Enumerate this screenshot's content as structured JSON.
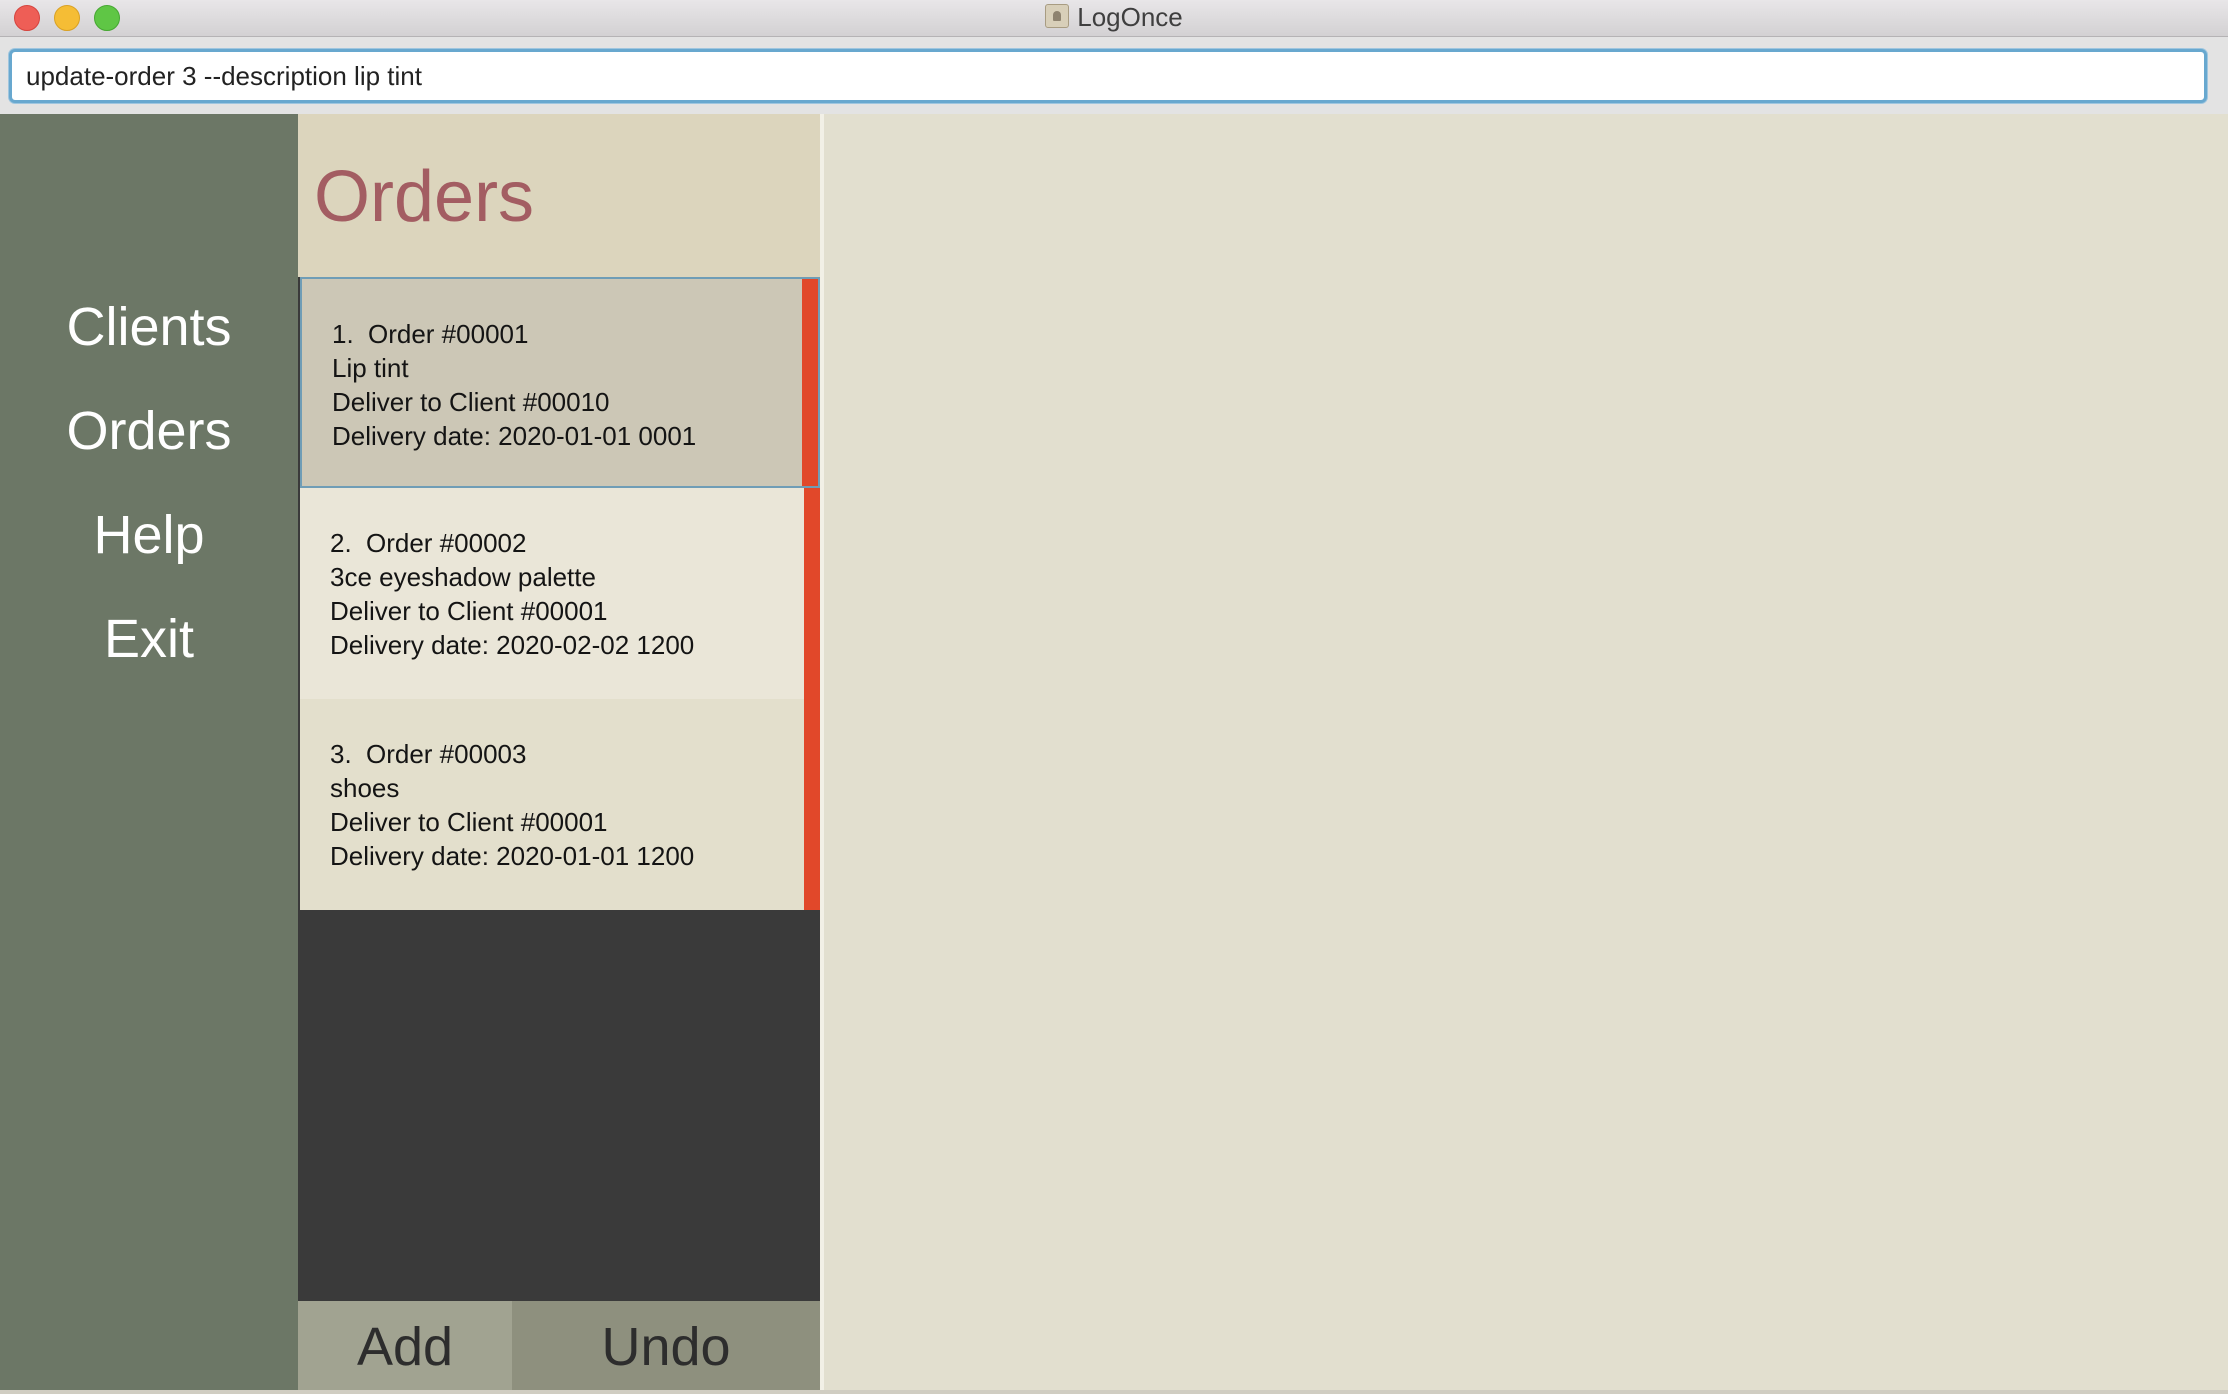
{
  "window": {
    "title": "LogOnce"
  },
  "command": {
    "value": "update-order 3 --description lip tint"
  },
  "sidebar": {
    "items": [
      {
        "label": "Clients"
      },
      {
        "label": "Orders"
      },
      {
        "label": "Help"
      },
      {
        "label": "Exit"
      }
    ]
  },
  "orders": {
    "title": "Orders",
    "list": [
      {
        "index": "1.",
        "order": "Order #00001",
        "description": "Lip tint",
        "client": "Deliver to Client #00010",
        "date": "Delivery date: 2020-01-01 0001"
      },
      {
        "index": "2.",
        "order": "Order #00002",
        "description": "3ce eyeshadow palette",
        "client": "Deliver to Client #00001",
        "date": "Delivery date: 2020-02-02 1200"
      },
      {
        "index": "3.",
        "order": "Order #00003",
        "description": "shoes",
        "client": "Deliver to Client #00001",
        "date": "Delivery date: 2020-01-01 1200"
      }
    ],
    "add_label": "Add",
    "undo_label": "Undo"
  },
  "colors": {
    "sidebar": "#6c7766",
    "accent_stripe": "#e1482a",
    "orders_title": "#a35d62",
    "selected_border": "#6f9db6"
  }
}
